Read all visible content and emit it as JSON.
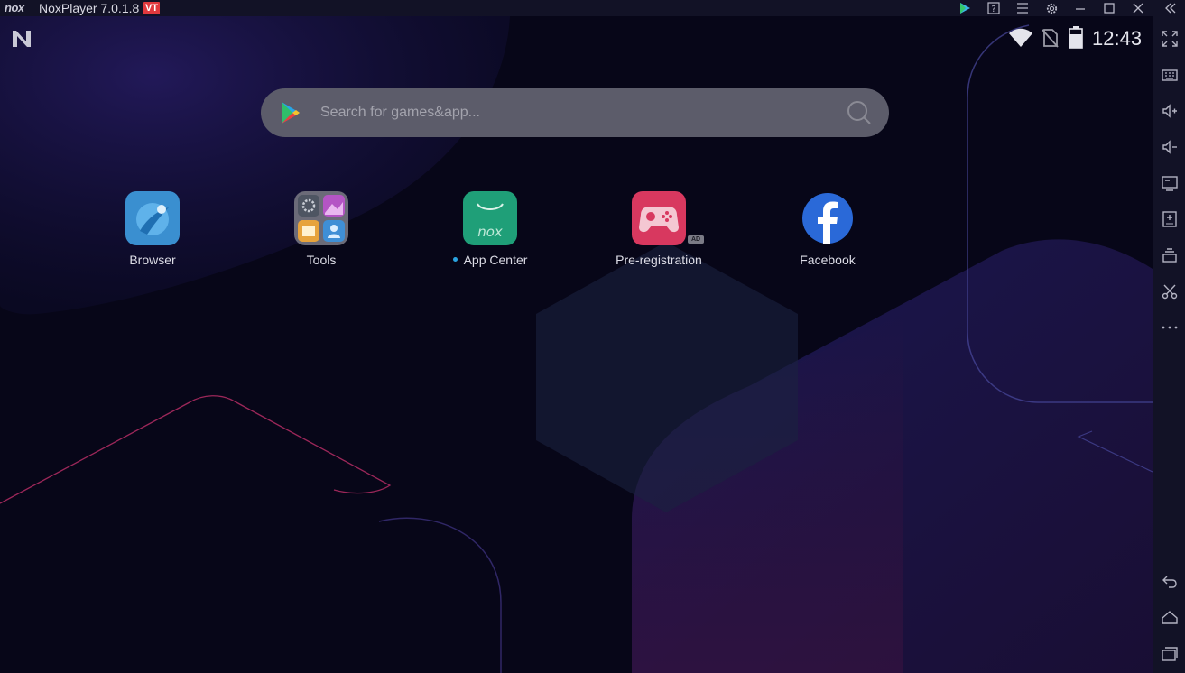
{
  "window": {
    "brand": "nox",
    "title": "NoxPlayer 7.0.1.8",
    "vt_badge": "VT",
    "controls": [
      "play-store-icon",
      "help-icon",
      "menu-icon",
      "settings-icon",
      "minimize-icon",
      "maximize-icon",
      "close-icon",
      "collapse-icon"
    ]
  },
  "status_bar": {
    "time": "12:43",
    "icons": [
      "nox-n-icon",
      "wifi-icon",
      "no-sim-icon",
      "battery-icon"
    ]
  },
  "search": {
    "placeholder": "Search for games&app..."
  },
  "apps": [
    {
      "label": "Browser",
      "icon": "browser-icon",
      "color": "#3a9ce0"
    },
    {
      "label": "Tools",
      "icon": "tools-folder-icon",
      "color": "#6b6b78"
    },
    {
      "label": "App Center",
      "icon": "app-center-icon",
      "color": "#1faa7f",
      "has_new_dot": true
    },
    {
      "label": "Pre-registration",
      "icon": "gamepad-icon",
      "color": "#e0406a",
      "badge": "AD"
    },
    {
      "label": "Facebook",
      "icon": "facebook-icon",
      "color": "#2a69d8"
    }
  ],
  "sidebar": {
    "buttons": [
      "fullscreen-icon",
      "keyboard-icon",
      "volume-up-icon",
      "volume-down-icon",
      "screen-icon",
      "add-apk-icon",
      "multi-instance-icon",
      "scissors-icon",
      "more-icon",
      "back-icon",
      "home-icon",
      "recents-icon"
    ]
  },
  "colors": {
    "titlebar": "#121226",
    "background": "#070618",
    "accent_pink": "#c2306a",
    "accent_blue": "#2a69d8"
  }
}
